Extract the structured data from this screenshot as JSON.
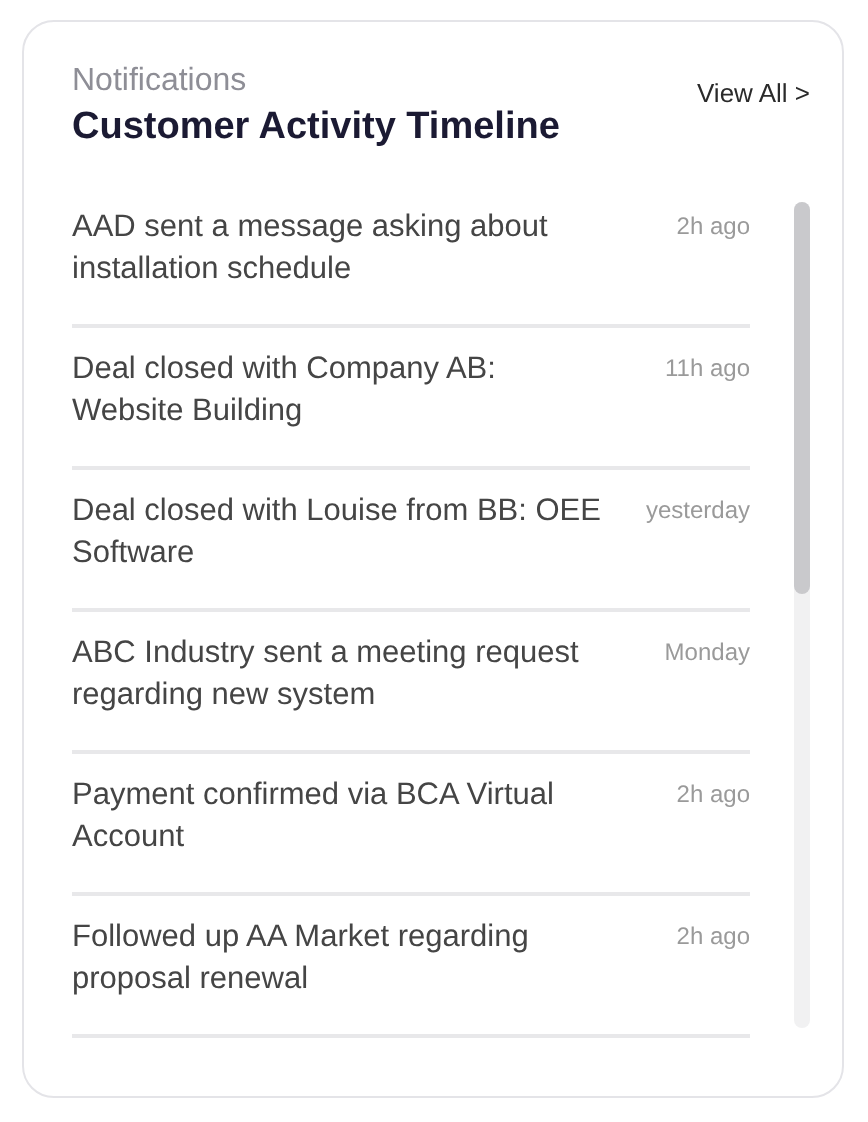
{
  "header": {
    "subtitle": "Notifications",
    "title": "Customer Activity Timeline",
    "link": "View All >"
  },
  "items": [
    {
      "text": "AAD sent a message asking about installation schedule",
      "time": "2h ago"
    },
    {
      "text": "Deal closed with Company AB: Website Building",
      "time": "11h ago"
    },
    {
      "text": "Deal closed with Louise from BB: OEE Software",
      "time": "yesterday"
    },
    {
      "text": "ABC Industry sent a meeting request regarding new system",
      "time": "Monday"
    },
    {
      "text": "Payment confirmed via BCA Virtual Account",
      "time": "2h ago"
    },
    {
      "text": "Followed up AA Market regarding proposal renewal",
      "time": "2h ago"
    }
  ]
}
